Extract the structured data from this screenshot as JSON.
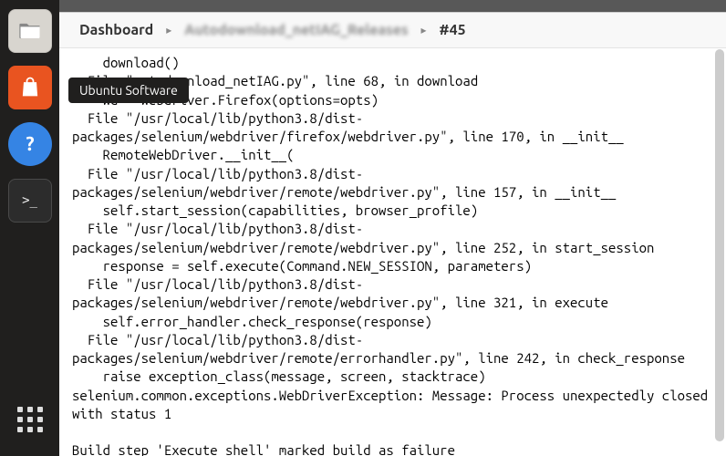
{
  "launcher": {
    "tooltip": "Ubuntu Software",
    "terminal_prompt": ">_"
  },
  "breadcrumb": {
    "items": [
      {
        "label": "Dashboard"
      },
      {
        "label": "Autodownload_netIAG_Releases"
      },
      {
        "label": "#45"
      }
    ],
    "sep": "▸"
  },
  "console": {
    "text": "    download()\n  File \"autodownload_netIAG.py\", line 68, in download\n    wd = webdriver.Firefox(options=opts)\n  File \"/usr/local/lib/python3.8/dist-packages/selenium/webdriver/firefox/webdriver.py\", line 170, in __init__\n    RemoteWebDriver.__init__(\n  File \"/usr/local/lib/python3.8/dist-packages/selenium/webdriver/remote/webdriver.py\", line 157, in __init__\n    self.start_session(capabilities, browser_profile)\n  File \"/usr/local/lib/python3.8/dist-packages/selenium/webdriver/remote/webdriver.py\", line 252, in start_session\n    response = self.execute(Command.NEW_SESSION, parameters)\n  File \"/usr/local/lib/python3.8/dist-packages/selenium/webdriver/remote/webdriver.py\", line 321, in execute\n    self.error_handler.check_response(response)\n  File \"/usr/local/lib/python3.8/dist-packages/selenium/webdriver/remote/errorhandler.py\", line 242, in check_response\n    raise exception_class(message, screen, stacktrace)\nselenium.common.exceptions.WebDriverException: Message: Process unexpectedly closed with status 1\n\nBuild step 'Execute shell' marked build as failure\nFinished: FAILURE"
  }
}
